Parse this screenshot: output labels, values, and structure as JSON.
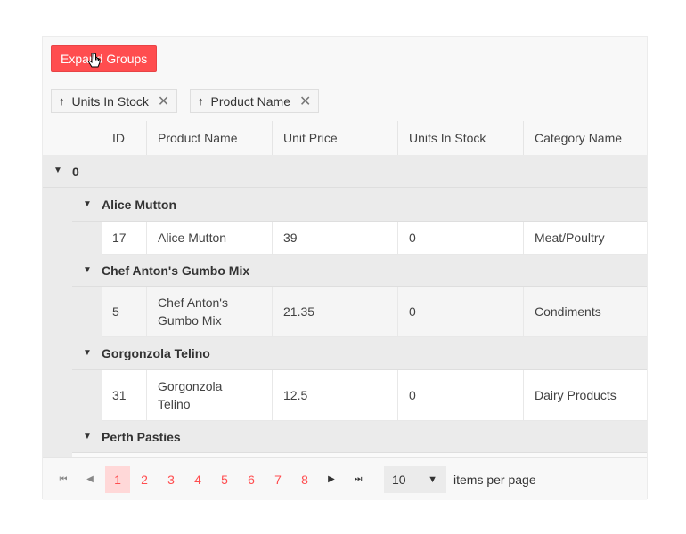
{
  "toolbar": {
    "expand_label": "Expand Groups"
  },
  "group_panel": {
    "chips": [
      {
        "label": "Units In Stock",
        "arrow": "↑",
        "remove": "✕"
      },
      {
        "label": "Product Name",
        "arrow": "↑",
        "remove": "✕"
      }
    ]
  },
  "columns": [
    "ID",
    "Product Name",
    "Unit Price",
    "Units In Stock",
    "Category Name"
  ],
  "groups": {
    "top": {
      "caret": "▼",
      "title": "0"
    },
    "subgroups": [
      {
        "caret": "▼",
        "title": "Alice Mutton",
        "row": {
          "id": "17",
          "name": "Alice Mutton",
          "price": "39",
          "stock": "0",
          "category": "Meat/Poultry"
        }
      },
      {
        "caret": "▼",
        "title": "Chef Anton's Gumbo Mix",
        "row": {
          "id": "5",
          "name": "Chef Anton's Gumbo Mix",
          "price": "21.35",
          "stock": "0",
          "category": "Condiments"
        }
      },
      {
        "caret": "▼",
        "title": "Gorgonzola Telino",
        "row": {
          "id": "31",
          "name": "Gorgonzola Telino",
          "price": "12.5",
          "stock": "0",
          "category": "Dairy Products"
        }
      },
      {
        "caret": "▼",
        "title": "Perth Pasties"
      }
    ]
  },
  "pager": {
    "first": "⏮",
    "prev": "◀",
    "next": "▶",
    "last": "⏭",
    "pages": [
      "1",
      "2",
      "3",
      "4",
      "5",
      "6",
      "7",
      "8"
    ],
    "active_page": "1",
    "page_size": "10",
    "page_size_caret": "▼",
    "info": "items per page"
  },
  "colors": {
    "accent": "#ff4d4f",
    "group_bg": "#ebebeb",
    "active_page_bg": "#ffd8d8"
  }
}
